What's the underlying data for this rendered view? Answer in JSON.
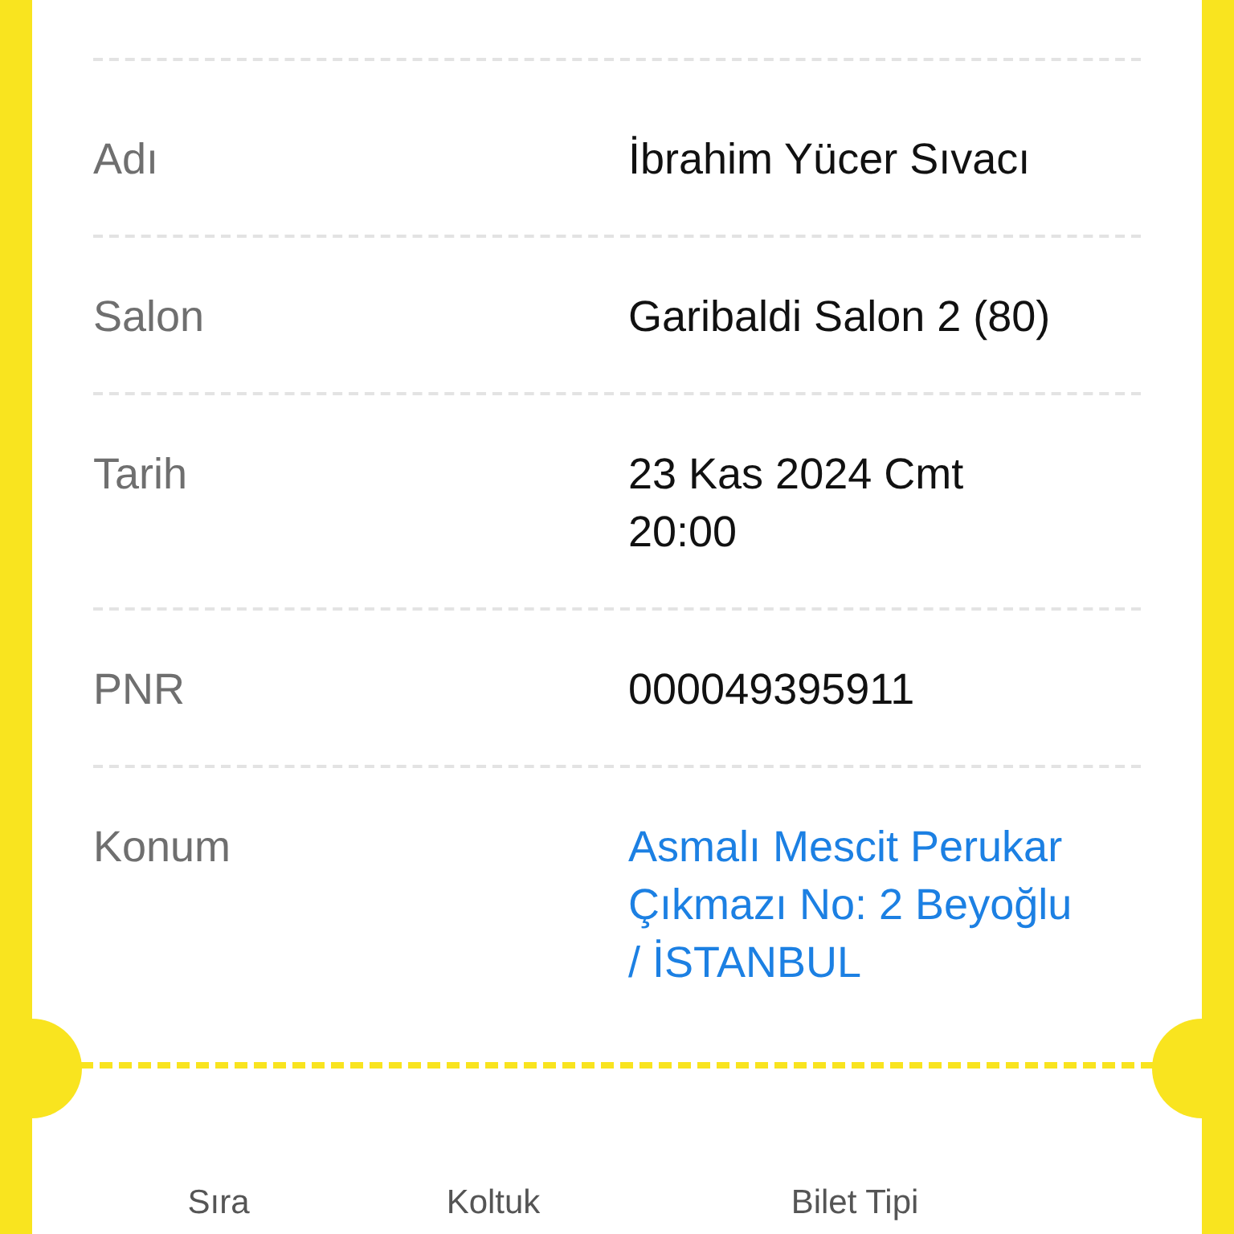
{
  "details": [
    {
      "label": "Adı",
      "value": "İbrahim Yücer Sıvacı",
      "kind": "text"
    },
    {
      "label": "Salon",
      "value": "Garibaldi Salon 2 (80)",
      "kind": "text"
    },
    {
      "label": "Tarih",
      "value": "23 Kas 2024 Cmt 20:00",
      "kind": "text"
    },
    {
      "label": "PNR",
      "value": "000049395911",
      "kind": "text"
    },
    {
      "label": "Konum",
      "value": "Asmalı Mescit Perukar Çıkmazı No: 2 Beyoğlu / İSTANBUL",
      "kind": "link"
    }
  ],
  "ticket_columns": [
    "Sıra",
    "Koltuk",
    "Bilet Tipi"
  ]
}
